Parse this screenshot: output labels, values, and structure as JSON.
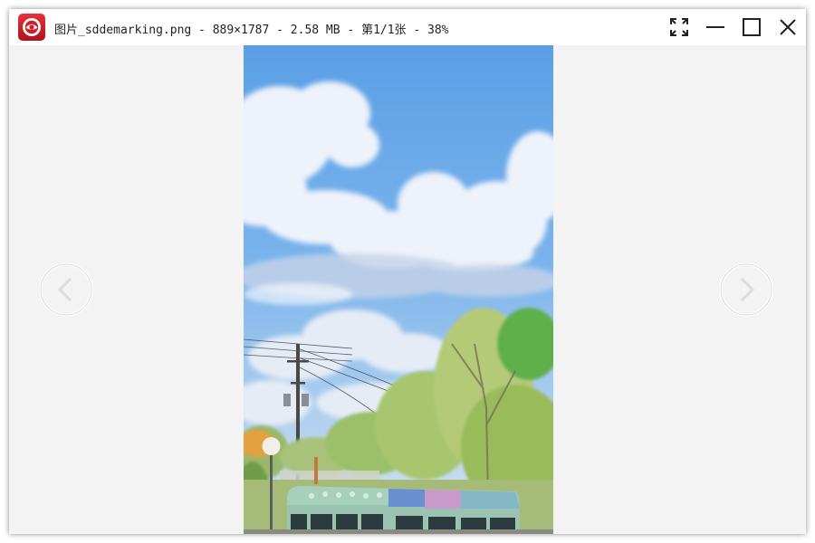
{
  "window": {
    "title": "图片_sddemarking.png - 889×1787 - 2.58 MB - 第1/1张 - 38%"
  },
  "icons": {
    "app": "app-logo-icon",
    "fullscreen": "fullscreen-icon",
    "minimize": "minimize-icon",
    "maximize": "maximize-icon",
    "close": "close-icon",
    "previous": "previous-arrow-icon",
    "next": "next-arrow-icon"
  },
  "colors": {
    "brand": "#d21f26",
    "viewer_background": "#f3f3f3",
    "titlebar_background": "#ffffff"
  }
}
